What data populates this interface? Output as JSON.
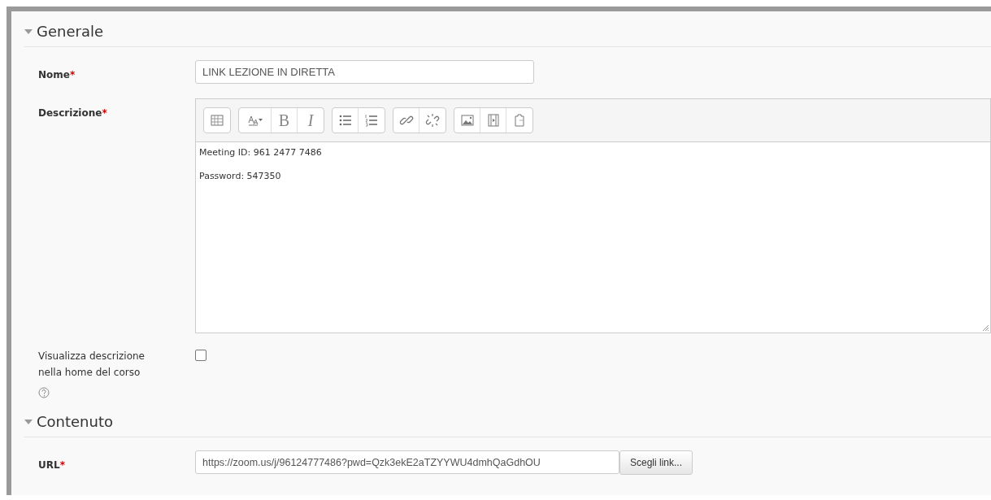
{
  "sections": [
    {
      "title": "Generale",
      "expanded": true,
      "fields": [
        {
          "kind": "text",
          "label": "Nome",
          "required_mark": "*",
          "value": "LINK LEZIONE IN DIRETTA"
        },
        {
          "kind": "editor",
          "label": "Descrizione",
          "required_mark": "*",
          "toolbar": [
            [
              {
                "kind": "table"
              }
            ],
            [
              {
                "kind": "font-size"
              },
              {
                "kind": "bold",
                "label": "B"
              },
              {
                "kind": "italic",
                "label": "I"
              }
            ],
            [
              {
                "kind": "bullet-list"
              },
              {
                "kind": "number-list"
              }
            ],
            [
              {
                "kind": "link"
              },
              {
                "kind": "unlink"
              }
            ],
            [
              {
                "kind": "image"
              },
              {
                "kind": "video"
              },
              {
                "kind": "paste"
              }
            ]
          ],
          "paragraphs": [
            "Meeting ID: 961 2477 7486",
            "Password: 547350"
          ]
        },
        {
          "kind": "checkbox",
          "label": "Visualizza descrizione nella home del corso",
          "checked": false,
          "help": true
        }
      ]
    },
    {
      "title": "Contenuto",
      "expanded": true,
      "fields": [
        {
          "kind": "url",
          "label": "URL",
          "required_mark": "*",
          "value": "https://zoom.us/j/96124777486?pwd=Qzk3ekE2aTZYYWU4dmhQaGdhOU",
          "button": "Scegli link..."
        }
      ]
    }
  ]
}
